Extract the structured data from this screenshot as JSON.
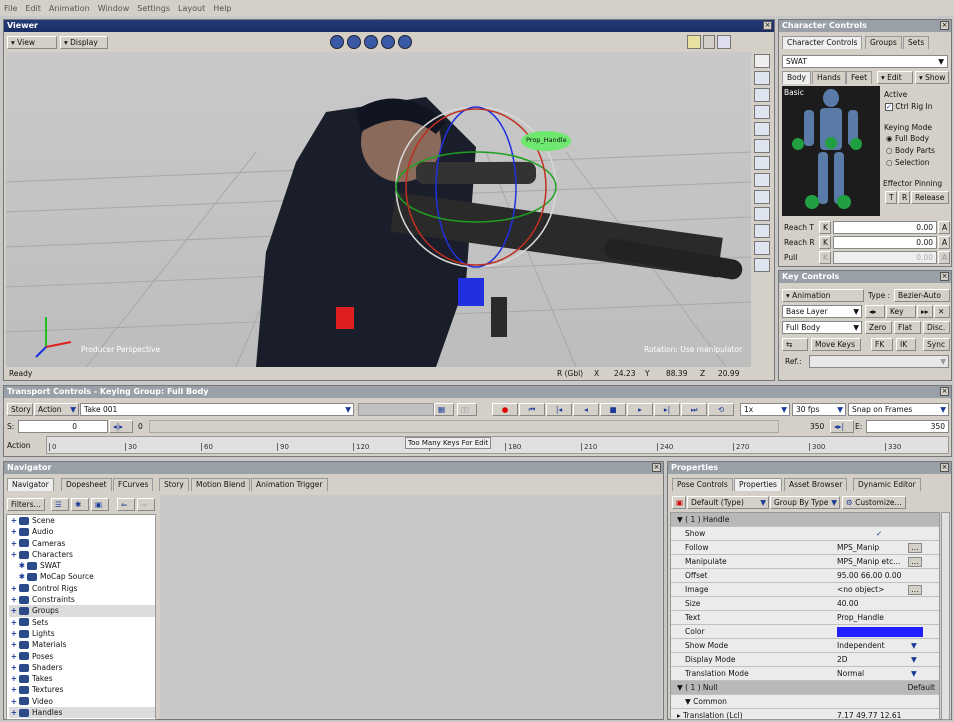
{
  "menu": [
    "File",
    "Edit",
    "Animation",
    "Window",
    "Settings",
    "Layout",
    "Help"
  ],
  "viewer": {
    "title": "Viewer",
    "view_btn": "View",
    "display_btn": "Display",
    "camera_label": "Producer Perspective",
    "mode_label": "Rotation: Use manipulator",
    "status": "Ready",
    "handle_label": "Prop_Handle",
    "coords": {
      "mode": "R (Gbl)",
      "x_label": "X",
      "x": "24.23",
      "y_label": "Y",
      "y": "88.39",
      "z_label": "Z",
      "z": "20.99"
    }
  },
  "character_controls": {
    "title": "Character Controls",
    "tabs": [
      "Character Controls",
      "Groups",
      "Sets"
    ],
    "character": "SWAT",
    "subtabs": [
      "Body",
      "Hands",
      "Feet"
    ],
    "edit_btn": "Edit",
    "show_btn": "Show",
    "basic_label": "Basic",
    "active_label": "Active",
    "ctrl_rig_in": "Ctrl Rig In",
    "keying_mode_label": "Keying Mode",
    "keying_modes": [
      "Full Body",
      "Body Parts",
      "Selection"
    ],
    "effector_pinning_label": "Effector Pinning",
    "pin_t": "T",
    "pin_r": "R",
    "release": "Release",
    "reach_t": "Reach T",
    "reach_r": "Reach R",
    "pull": "Pull",
    "k": "K",
    "a": "A",
    "reach_t_val": "0.00",
    "reach_r_val": "0.00",
    "pull_val": "0.00"
  },
  "key_controls": {
    "title": "Key Controls",
    "mode": "Animation",
    "type_label": "Type :",
    "type": "Bezier-Auto",
    "layer": "Base Layer",
    "key_btn": "Key",
    "body": "Full Body",
    "zero": "Zero",
    "flat": "Flat",
    "disc": "Disc.",
    "move_keys": "Move Keys",
    "fk": "FK",
    "ik": "IK",
    "sync": "Sync",
    "ref_label": "Ref.:"
  },
  "transport": {
    "title": "Transport Controls  -  Keying Group: Full Body",
    "story": "Story",
    "action": "Action",
    "take": "Take 001",
    "speed": "1x",
    "fps": "30 fps",
    "snap": "Snap on Frames",
    "s_label": "S:",
    "s_value": "0",
    "current_frame": "0",
    "end_frame": "350",
    "e_label": "E:",
    "e_value": "350",
    "track_label": "Action",
    "tooltip": "Too Many Keys For Edit",
    "ticks": [
      "0",
      "30",
      "60",
      "90",
      "120",
      "150",
      "180",
      "210",
      "240",
      "270",
      "300",
      "330"
    ]
  },
  "navigator": {
    "title": "Navigator",
    "tabs": [
      "Navigator",
      "Dopesheet",
      "FCurves",
      "Story",
      "Motion Blend",
      "Animation Trigger"
    ],
    "filters": "Filters...",
    "tree": [
      {
        "label": "Scene",
        "level": 0
      },
      {
        "label": "Audio",
        "level": 0
      },
      {
        "label": "Cameras",
        "level": 0
      },
      {
        "label": "Characters",
        "level": 0
      },
      {
        "label": "SWAT",
        "level": 1
      },
      {
        "label": "MoCap Source",
        "level": 1
      },
      {
        "label": "Control Rigs",
        "level": 0
      },
      {
        "label": "Constraints",
        "level": 0
      },
      {
        "label": "Groups",
        "level": 0
      },
      {
        "label": "Sets",
        "level": 0
      },
      {
        "label": "Lights",
        "level": 0
      },
      {
        "label": "Materials",
        "level": 0
      },
      {
        "label": "Poses",
        "level": 0
      },
      {
        "label": "Shaders",
        "level": 0
      },
      {
        "label": "Takes",
        "level": 0
      },
      {
        "label": "Textures",
        "level": 0
      },
      {
        "label": "Video",
        "level": 0
      },
      {
        "label": "Handles",
        "level": 0
      }
    ]
  },
  "properties": {
    "title": "Properties",
    "tabs": [
      "Pose Controls",
      "Properties",
      "Asset Browser",
      "Dynamic Editor"
    ],
    "preset": "Default (Type)",
    "group_by": "Group By Type",
    "customize": "Customize...",
    "section": "( 1 ) Handle",
    "rows": [
      {
        "name": "Show",
        "value": ""
      },
      {
        "name": "Follow",
        "value": "MPS_Manip"
      },
      {
        "name": "Manipulate",
        "value": "MPS_Manip etc..."
      },
      {
        "name": "Offset",
        "value": "95.00   66.00   0.00"
      },
      {
        "name": "Image",
        "value": "<no object>"
      },
      {
        "name": "Size",
        "value": "40.00"
      },
      {
        "name": "Text",
        "value": "Prop_Handle"
      },
      {
        "name": "Color",
        "value": ""
      },
      {
        "name": "Show Mode",
        "value": "Independent"
      },
      {
        "name": "Display Mode",
        "value": "2D"
      },
      {
        "name": "Translation Mode",
        "value": "Normal"
      }
    ],
    "null_section": "( 1 ) Null",
    "null_default": "Default",
    "common": "Common",
    "translation_label": "Translation (Lcl)",
    "translation_value": "7.17   49.77   12.61"
  }
}
